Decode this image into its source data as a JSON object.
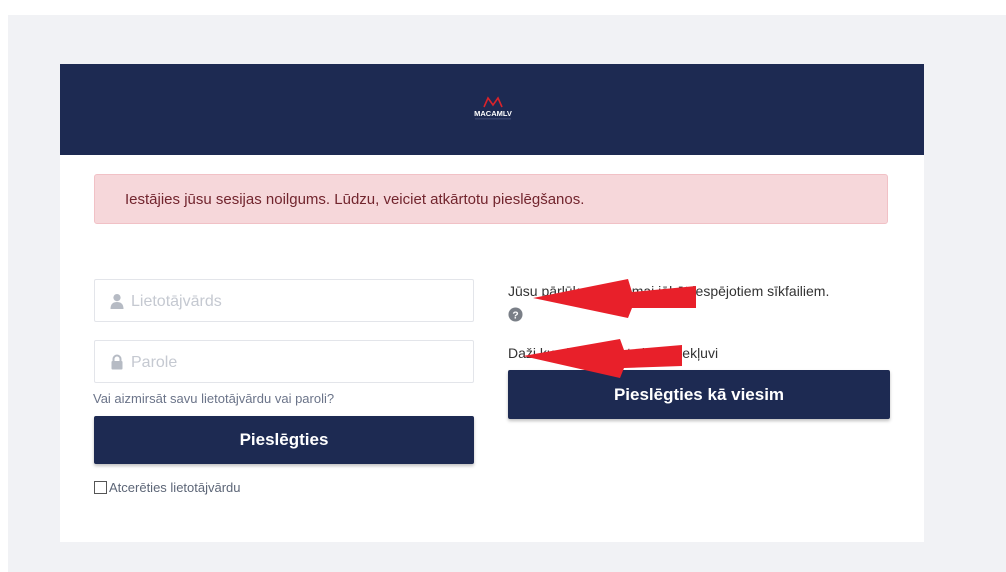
{
  "brand": {
    "logo_text": "MACAMLV"
  },
  "alert": {
    "message": "Iestājies jūsu sesijas noilgums. Lūdzu, veiciet atkārtotu pieslēgšanos."
  },
  "login": {
    "username_placeholder": "Lietotājvārds",
    "password_placeholder": "Parole",
    "forgot_link": "Vai aizmirsāt savu lietotājvārdu vai paroli?",
    "submit_label": "Pieslēgties",
    "remember_label": "Atcerēties lietotājvārdu"
  },
  "guest": {
    "cookies_notice": "Jūsu pārlūkprogrammai jābūt iespējotiem sīkfailiem.",
    "guest_notice": "Daži kursi var atļaut viesu piekļuvi",
    "guest_button_label": "Pieslēgties kā viesim"
  },
  "colors": {
    "header_bg": "#1d2a52",
    "button_bg": "#1d2a52",
    "alert_bg": "#f6d7da",
    "alert_text": "#72252e",
    "arrow_red": "#e8202a",
    "logo_red": "#d9232b"
  },
  "icons": {
    "username": "user-icon",
    "password": "lock-icon",
    "help": "question-circle-icon"
  }
}
